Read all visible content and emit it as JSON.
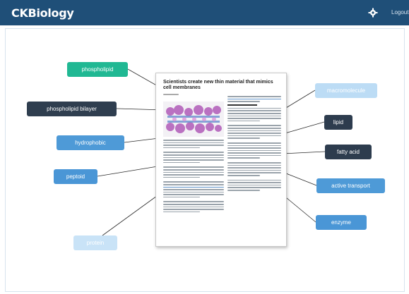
{
  "header": {
    "logo_prefix": "CK",
    "logo_suffix": "Biology",
    "logout_label": "Logout"
  },
  "article": {
    "title": "Scientists create new thin material that mimics cell membranes"
  },
  "tags": {
    "left": [
      "phospholipid",
      "phospholipid bilayer",
      "hydrophobic",
      "peptoid",
      "protein"
    ],
    "right": [
      "macromolecule",
      "lipid",
      "fatty acid",
      "active transport",
      "enzyme"
    ]
  },
  "colors": {
    "header_bg": "#1f4f78",
    "teal": "#20b893",
    "dark": "#2f3e4f",
    "blue": "#4e9ad7",
    "light_blue": "#c9e3f7"
  },
  "icons": {
    "settings": "gear-icon"
  }
}
